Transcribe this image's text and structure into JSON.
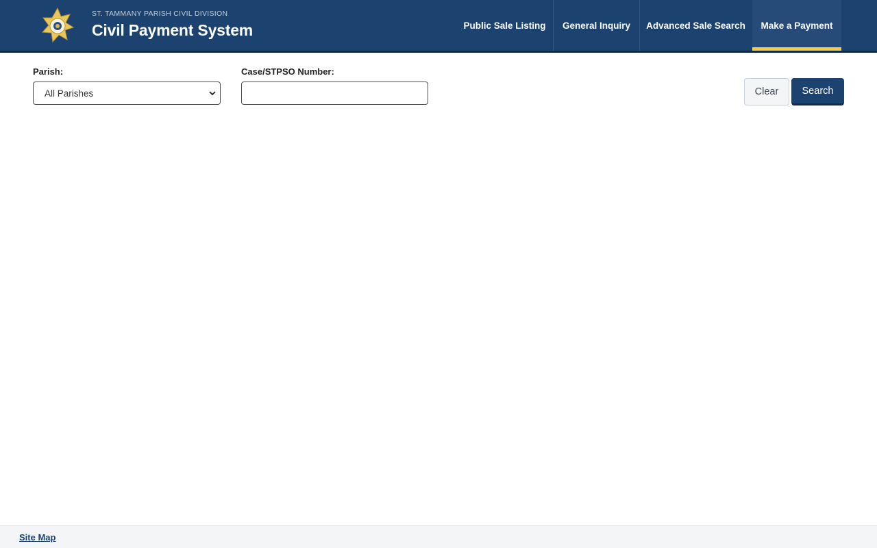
{
  "header": {
    "agency": "ST. TAMMANY PARISH CIVIL DIVISION",
    "title": "Civil Payment System",
    "logo_icon": "sheriff-star-badge",
    "nav": [
      {
        "label": "Public Sale Listing",
        "active": false
      },
      {
        "label": "General Inquiry",
        "active": false
      },
      {
        "label": "Advanced Sale Search",
        "active": false
      },
      {
        "label": "Make a Payment",
        "active": true
      }
    ]
  },
  "form": {
    "parish_label": "Parish:",
    "parish_selected": "All Parishes",
    "case_label": "Case/STPSO Number:",
    "case_value": "",
    "case_placeholder": ""
  },
  "buttons": {
    "clear": "Clear",
    "search": "Search"
  },
  "footer": {
    "site_map": "Site Map"
  },
  "colors": {
    "primary": "#1c4270",
    "accent": "#f7c948",
    "background": "#ffffff",
    "footer": "#f4f5f7"
  }
}
